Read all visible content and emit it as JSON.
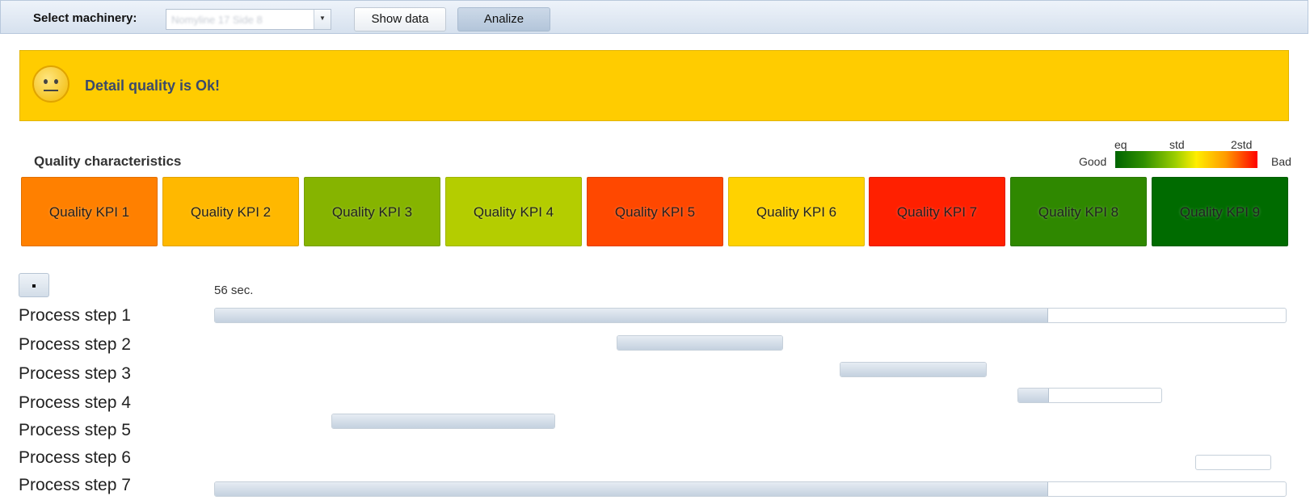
{
  "toolbar": {
    "label": "Select machinery:",
    "machinery_value": "Nomyline 17 Side 8",
    "show_data_label": "Show data",
    "analize_label": "Analize"
  },
  "banner": {
    "message": "Detail quality is Ok!",
    "color": "#ffcc00"
  },
  "quality": {
    "title": "Quality characteristics",
    "legend": {
      "good": "Good",
      "bad": "Bad",
      "eq": "eq",
      "std": "std",
      "std2": "2std"
    },
    "kpis": [
      {
        "label": "Quality KPI 1",
        "color": "#ff8000"
      },
      {
        "label": "Quality KPI 2",
        "color": "#ffb800"
      },
      {
        "label": "Quality KPI 3",
        "color": "#86b400"
      },
      {
        "label": "Quality KPI 4",
        "color": "#b4cd00"
      },
      {
        "label": "Quality KPI 5",
        "color": "#ff4800"
      },
      {
        "label": "Quality KPI 6",
        "color": "#ffd200"
      },
      {
        "label": "Quality KPI 7",
        "color": "#ff2000"
      },
      {
        "label": "Quality KPI 8",
        "color": "#2f8800"
      },
      {
        "label": "Quality KPI 9",
        "color": "#006b00"
      }
    ]
  },
  "process": {
    "duration_label": "56 sec.",
    "steps": [
      {
        "label": "Process step 1",
        "start": 0.0,
        "end": 1.0,
        "progress": 0.777
      },
      {
        "label": "Process step 2",
        "start": 0.375,
        "end": 0.53,
        "progress": 1.0
      },
      {
        "label": "Process step 3",
        "start": 0.583,
        "end": 0.72,
        "progress": 1.0
      },
      {
        "label": "Process step 4",
        "start": 0.749,
        "end": 0.884,
        "progress": 0.21
      },
      {
        "label": "Process step 5",
        "start": 0.109,
        "end": 0.318,
        "progress": 1.0
      },
      {
        "label": "Process step 6",
        "start": 0.915,
        "end": 0.986,
        "progress": 0.0
      },
      {
        "label": "Process step 7",
        "start": 0.0,
        "end": 1.0,
        "progress": 0.777
      }
    ]
  }
}
